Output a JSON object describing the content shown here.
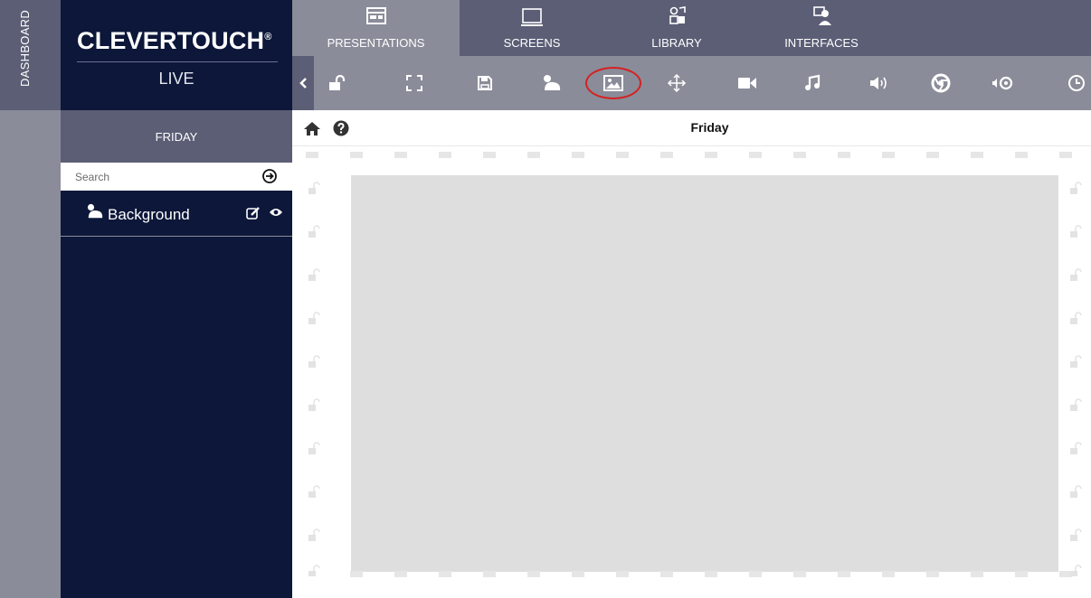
{
  "rail": {
    "label": "DASHBOARD"
  },
  "brand": {
    "name": "CLEVERTOUCH",
    "mark": "®",
    "sub": "LIVE"
  },
  "nav": {
    "tabs": [
      {
        "label": "PRESENTATIONS",
        "icon": "presentation-icon",
        "active": true
      },
      {
        "label": "SCREENS",
        "icon": "monitor-icon",
        "active": false
      },
      {
        "label": "LIBRARY",
        "icon": "library-media-icon",
        "active": false
      },
      {
        "label": "INTERFACES",
        "icon": "user-screen-icon",
        "active": false
      }
    ]
  },
  "toolbar": {
    "buttons": [
      "collapse-chevron-icon",
      "unlock-icon",
      "fullscreen-icon",
      "save-icon",
      "background-layer-icon",
      "image-icon",
      "move-arrows-icon",
      "video-camera-icon",
      "music-note-icon",
      "volume-icon",
      "chrome-browser-icon",
      "chrome-audio-icon",
      "clock-icon"
    ],
    "highlighted": "image-icon"
  },
  "sidebar": {
    "title": "FRIDAY",
    "search_placeholder": "Search",
    "layers": [
      {
        "name": "Background",
        "icon": "background-layer-icon"
      }
    ]
  },
  "main": {
    "page_title": "Friday"
  },
  "colors": {
    "navy": "#0c1739",
    "slate": "#5b5e75",
    "grey": "#8a8c99",
    "canvas": "#dedede",
    "highlight": "#d62020"
  }
}
